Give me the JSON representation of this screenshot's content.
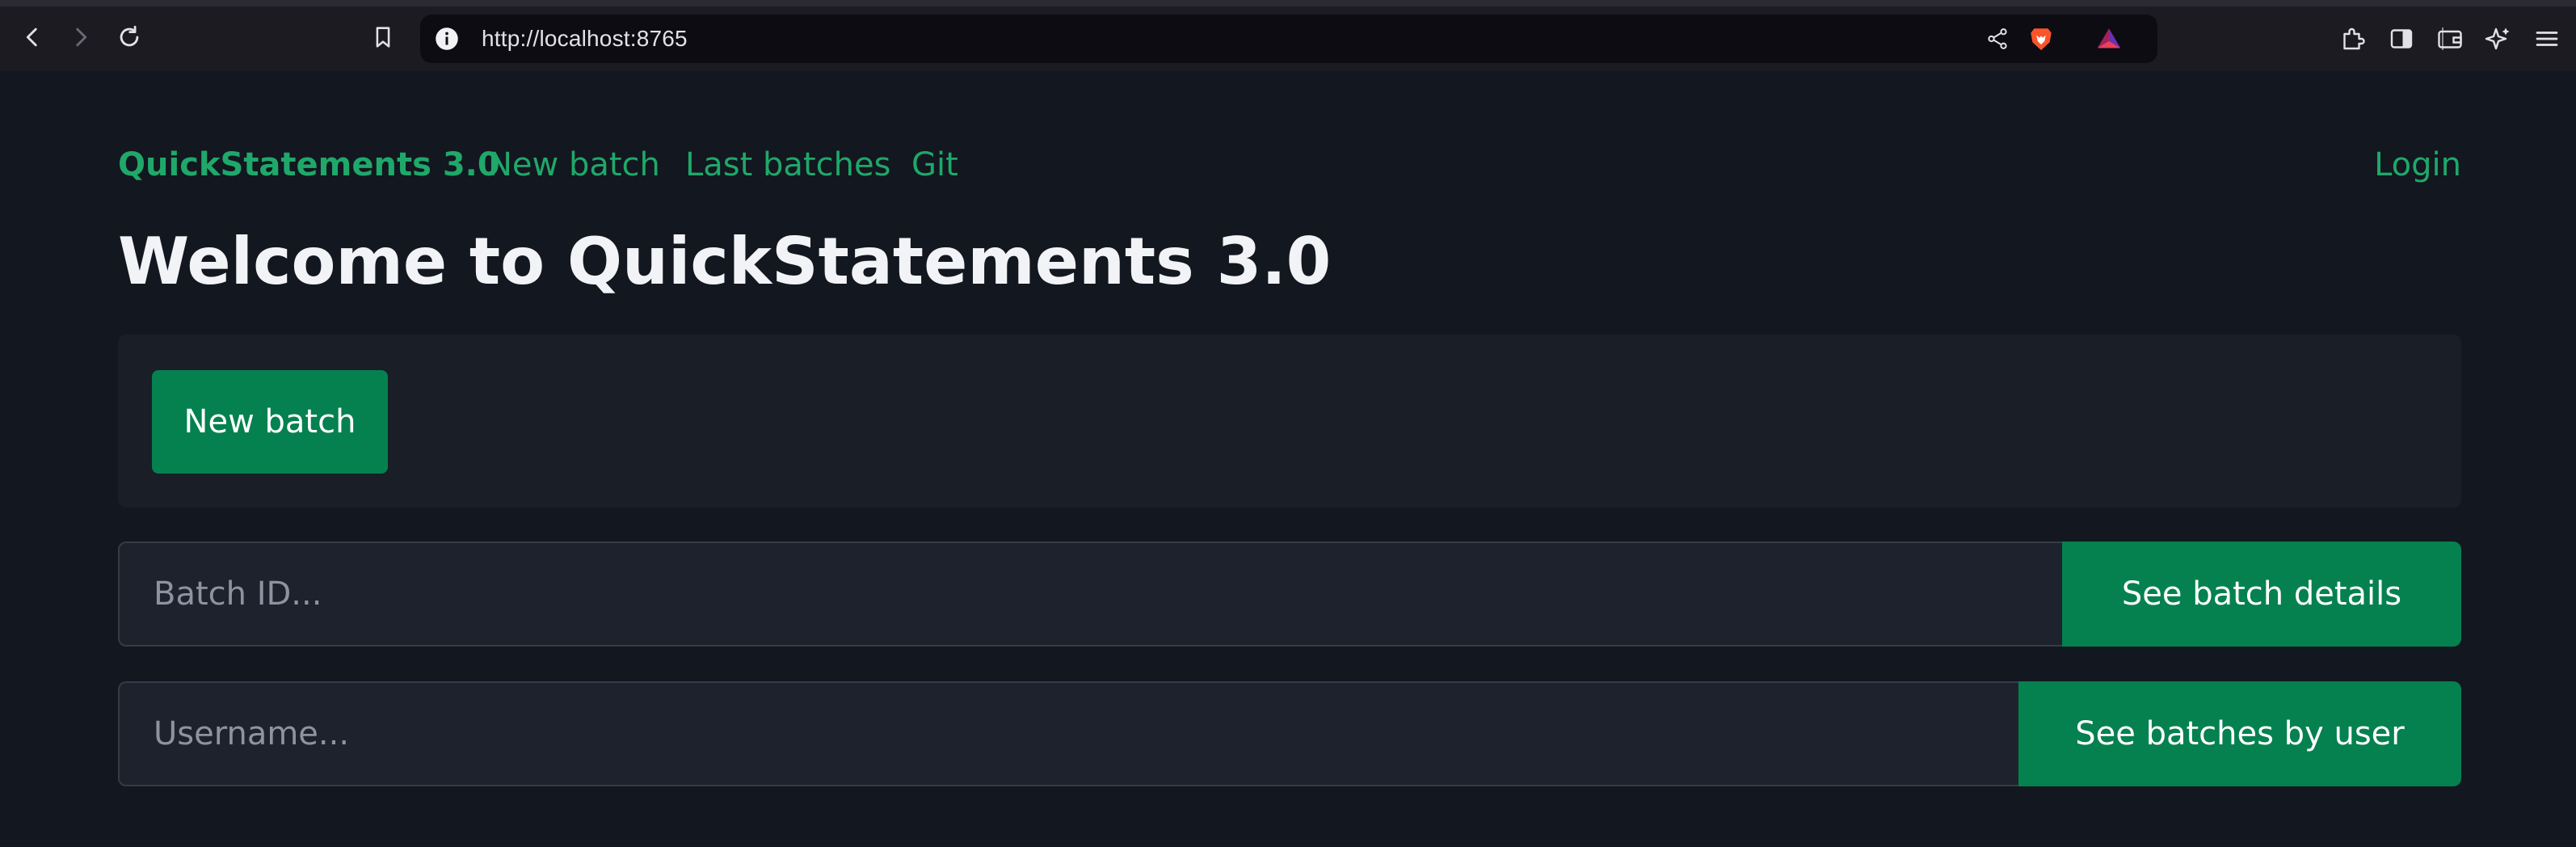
{
  "browser": {
    "url": "http://localhost:8765",
    "icons": {
      "back": "back-arrow-icon",
      "forward": "forward-arrow-icon",
      "reload": "reload-icon",
      "bookmark": "bookmark-icon",
      "site_info": "info-icon",
      "share": "share-icon",
      "brave_shields": "brave-lion-icon",
      "brave_rewards": "rewards-triangle-icon",
      "extensions": "puzzle-icon",
      "sidebar": "sidebar-icon",
      "wallet": "wallet-icon",
      "leo": "sparkle-icon",
      "menu": "hamburger-icon"
    }
  },
  "navbar": {
    "brand": "QuickStatements 3.0",
    "links": [
      "New batch",
      "Last batches",
      "Git"
    ],
    "login": "Login"
  },
  "main": {
    "title": "Welcome to QuickStatements 3.0",
    "new_batch_button": "New batch",
    "batch_lookup": {
      "placeholder": "Batch ID...",
      "button": "See batch details"
    },
    "user_lookup": {
      "placeholder": "Username...",
      "button": "See batches by user"
    }
  },
  "colors": {
    "background": "#13171f",
    "accent_link": "#1fa86a",
    "button": "#04814f",
    "card": "#1a1e27"
  }
}
